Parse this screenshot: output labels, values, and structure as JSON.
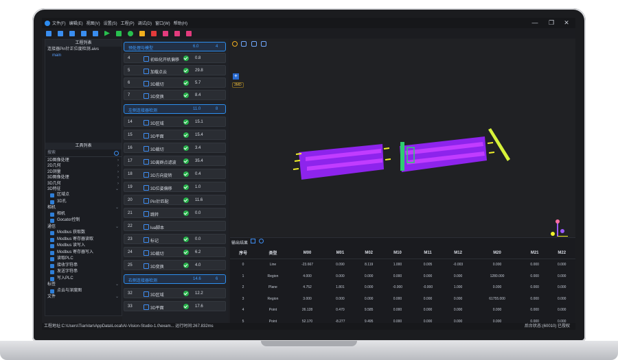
{
  "menu": [
    "文件(F)",
    "编辑(E)",
    "视图(V)",
    "设置(S)",
    "工程(P)",
    "调试(D)",
    "窗口(W)",
    "帮助(H)"
  ],
  "left_panel": {
    "project_title": "工程列表",
    "project_file": "连接器Pin针正位度检测.aivs",
    "project_sub": "main",
    "tools_title": "工具列表",
    "search_placeholder": "搜索",
    "categories_top": [
      "2D图像处理",
      "2D几何",
      "2D测量",
      "3D图像处理",
      "3D几何",
      "3D特征"
    ],
    "feature_items": [
      "区域点",
      "3D孔"
    ],
    "camera_cat": "相机",
    "camera_items": [
      "相机",
      "Gocator控制"
    ],
    "comm_cat": "通信",
    "comm_items": [
      "Modbus 获取数",
      "Modbus 寄存器读取",
      "Modbus 读写入",
      "Modbus 寄存器写入",
      "读取PLC",
      "接收字符串",
      "发送字符串",
      "写入PLC"
    ],
    "tail_cats": [
      "标签",
      "文件"
    ],
    "tail_items": [
      "点云与深度图"
    ]
  },
  "flow": {
    "groups": [
      {
        "name": "预处理与模型",
        "time": "6.0",
        "count": "4"
      },
      {
        "name": "左侧连接器检测",
        "time": "11.0",
        "count": "8"
      },
      {
        "name": "右侧连接器检测",
        "time": "14.6",
        "count": "6"
      }
    ],
    "steps_a": [
      {
        "num": "4",
        "name": "初始化开机偏移",
        "time": "0.8"
      },
      {
        "num": "5",
        "name": "加载点云",
        "time": "29.8"
      },
      {
        "num": "6",
        "name": "3D裁切",
        "time": "5.7"
      },
      {
        "num": "7",
        "name": "3D变换",
        "time": "8.4"
      }
    ],
    "steps_b": [
      {
        "num": "14",
        "name": "3D区域",
        "time": "15.1"
      },
      {
        "num": "15",
        "name": "3D平面",
        "time": "15.4"
      },
      {
        "num": "16",
        "name": "3D裁切",
        "time": "3.4"
      },
      {
        "num": "17",
        "name": "3D离群点滤波",
        "time": "35.4"
      },
      {
        "num": "18",
        "name": "3D方向旋转",
        "time": "0.4"
      },
      {
        "num": "19",
        "name": "3D位姿偏移",
        "time": "1.0"
      },
      {
        "num": "20",
        "name": "Pin针匹配",
        "time": "11.6"
      },
      {
        "num": "21",
        "name": "跳转",
        "time": "0.0"
      },
      {
        "num": "22",
        "name": "lua脚本",
        "time": ""
      },
      {
        "num": "23",
        "name": "标记",
        "time": "0.0"
      },
      {
        "num": "24",
        "name": "3D裁切",
        "time": "6.2"
      },
      {
        "num": "25",
        "name": "3D变换",
        "time": "4.0"
      }
    ],
    "steps_c": [
      {
        "num": "32",
        "name": "3D区域",
        "time": "12.2"
      },
      {
        "num": "33",
        "name": "3D平面",
        "time": "17.6"
      }
    ]
  },
  "viewer": {
    "model_badge": "3MD",
    "colors": {
      "cloud": "#9b2cf6",
      "pin": "#e8e84a",
      "fixture": "#2ecc71",
      "axis_x": "#f2f22a",
      "axis_y": "#9b59ff",
      "axis_z": "#ff6fa3"
    }
  },
  "results": {
    "title": "输出结果",
    "headers": [
      "序号",
      "类型",
      "M00",
      "M01",
      "M02",
      "M10",
      "M11",
      "M12",
      "M20",
      "M21",
      "M22"
    ],
    "rows": [
      [
        "0",
        "Line",
        "-23.667",
        "0.090",
        "8.119",
        "1.000",
        "0.005",
        "-0.003",
        "0.000",
        "0.000",
        "0.000"
      ],
      [
        "1",
        "Region",
        "4.000",
        "0.000",
        "0.000",
        "0.000",
        "0.000",
        "0.000",
        "1280.000",
        "0.000",
        "0.000"
      ],
      [
        "2",
        "Plane",
        "4.752",
        "1.801",
        "0.000",
        "-0.000",
        "-0.000",
        "1.000",
        "0.000",
        "0.000",
        "0.000"
      ],
      [
        "3",
        "Region",
        "3.000",
        "0.000",
        "0.000",
        "0.000",
        "0.000",
        "0.000",
        "61755.000",
        "0.000",
        "0.000"
      ],
      [
        "4",
        "Point",
        "26.128",
        "0.470",
        "9.585",
        "0.000",
        "0.000",
        "0.000",
        "0.000",
        "0.000",
        "0.000"
      ],
      [
        "5",
        "Point",
        "52.170",
        "-8.277",
        "9.495",
        "0.000",
        "0.000",
        "0.000",
        "0.000",
        "0.000",
        "0.000"
      ]
    ]
  },
  "status": {
    "left": "工程地址:C:\\Users\\TianVan\\AppData\\Local\\AI-Vision-Studio-1.0\\exam...  运行时间:267.832ms",
    "right": "后台状态:(60010)  已授权"
  }
}
